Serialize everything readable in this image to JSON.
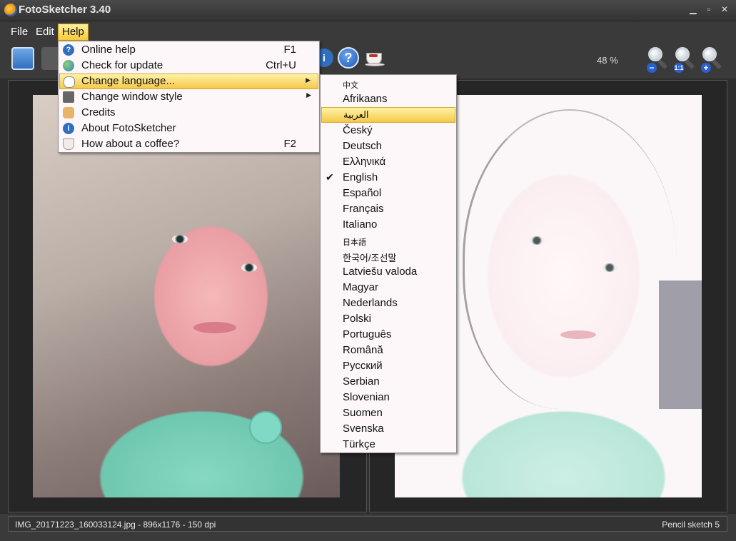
{
  "window": {
    "title": "FotoSketcher 3.40"
  },
  "menubar": {
    "file": "File",
    "edit": "Edit",
    "help": "Help"
  },
  "toolbar": {
    "zoom": "48 %"
  },
  "help_menu": {
    "items": [
      {
        "label": "Online help",
        "shortcut": "F1",
        "icon": "help-icon"
      },
      {
        "label": "Check for update",
        "shortcut": "Ctrl+U",
        "icon": "globe-icon"
      },
      {
        "label": "Change language...",
        "shortcut": "",
        "icon": "speech-bubble-icon"
      },
      {
        "label": "Change window style",
        "shortcut": "",
        "icon": "window-icon"
      },
      {
        "label": "Credits",
        "shortcut": "",
        "icon": "thumbs-up-icon"
      },
      {
        "label": "About FotoSketcher",
        "shortcut": "",
        "icon": "info-icon"
      },
      {
        "label": "How about a coffee?",
        "shortcut": "F2",
        "icon": "coffee-icon"
      }
    ]
  },
  "languages": [
    "中文",
    "Afrikaans",
    "العربية",
    "Český",
    "Deutsch",
    "Ελληνικά",
    "English",
    "Español",
    "Français",
    "Italiano",
    "日本語",
    "한국어/조선말",
    "Latviešu valoda",
    "Magyar",
    "Nederlands",
    "Polski",
    "Português",
    "Română",
    "Русский",
    "Serbian",
    "Slovenian",
    "Suomen",
    "Svenska",
    "Türkçe"
  ],
  "languages_checked": "English",
  "status": {
    "left": "IMG_20171223_160033124.jpg - 896x1176 - 150 dpi",
    "right": "Pencil sketch 5"
  },
  "colors": {
    "highlight": "#f5c84a",
    "menu_bg": "#fdf7fa",
    "chrome": "#3a3a3a"
  }
}
